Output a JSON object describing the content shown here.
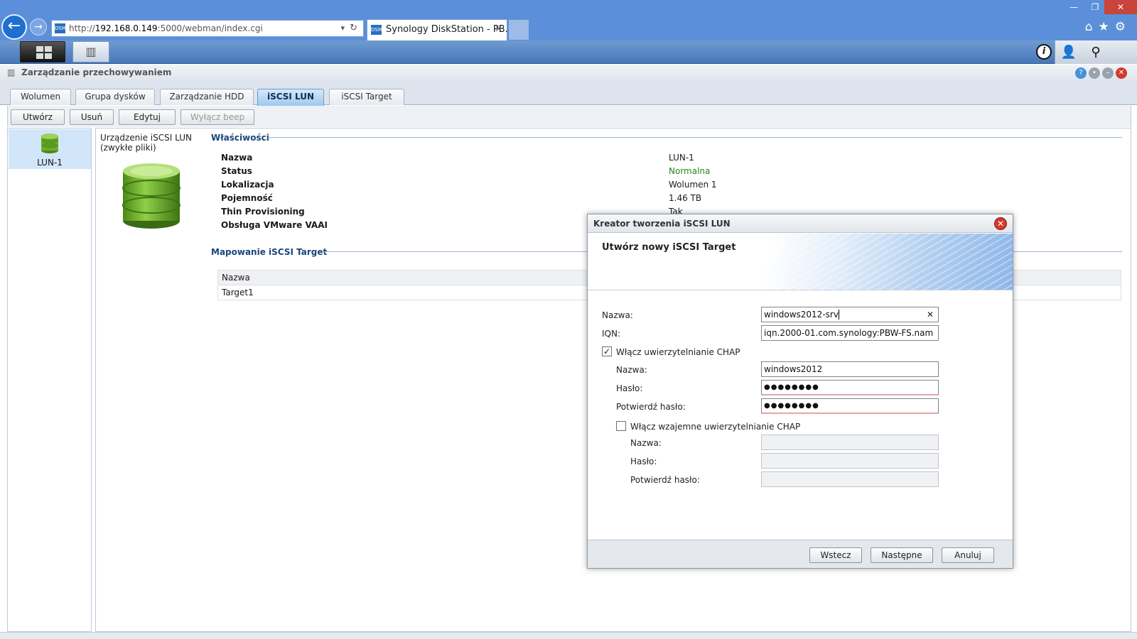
{
  "browser": {
    "address_prefix": "http://",
    "address_host": "192.168.0.149",
    "address_rest": ":5000/webman/index.cgi",
    "tab_title": "Synology DiskStation - PB...",
    "favicon_text": "DSM"
  },
  "app": {
    "title": "Zarządzanie przechowywaniem",
    "tabs": [
      "Wolumen",
      "Grupa dysków",
      "Zarządzanie HDD",
      "iSCSI LUN",
      "iSCSI Target"
    ],
    "active_tab": "iSCSI LUN"
  },
  "toolbar": {
    "create": "Utwórz",
    "delete": "Usuń",
    "edit": "Edytuj",
    "beep_off": "Wyłącz beep"
  },
  "lun_list": [
    {
      "label": "LUN-1"
    }
  ],
  "device": {
    "line1": "Urządzenie iSCSI LUN",
    "line2": "(zwykłe pliki)"
  },
  "properties": {
    "heading": "Właściwości",
    "rows": [
      {
        "key": "Nazwa",
        "value": "LUN-1"
      },
      {
        "key": "Status",
        "value": "Normalna"
      },
      {
        "key": "Lokalizacja",
        "value": "Wolumen 1"
      },
      {
        "key": "Pojemność",
        "value": "1.46 TB"
      },
      {
        "key": "Thin Provisioning",
        "value": "Tak"
      },
      {
        "key": "Obsługa VMware VAAI",
        "value": ""
      }
    ],
    "status_color": "#1f8a1f"
  },
  "mapping": {
    "heading": "Mapowanie iSCSI Target",
    "column": "Nazwa",
    "rows": [
      "Target1"
    ]
  },
  "wizard": {
    "title": "Kreator tworzenia iSCSI LUN",
    "step_title": "Utwórz nowy iSCSI Target",
    "name_label": "Nazwa:",
    "name_value": "windows2012-srv",
    "iqn_label": "IQN:",
    "iqn_value": "iqn.2000-01.com.synology:PBW-FS.nam",
    "chap_label": "Włącz uwierzytelnianie CHAP",
    "chap_checked": "✓",
    "chap_name_label": "Nazwa:",
    "chap_name_value": "windows2012",
    "chap_pass_label": "Hasło:",
    "chap_pass_value": "●●●●●●●●",
    "chap_confirm_label": "Potwierdź hasło:",
    "chap_confirm_value": "●●●●●●●●",
    "mutual_label": "Włącz wzajemne uwierzytelnianie CHAP",
    "mutual_name_label": "Nazwa:",
    "mutual_pass_label": "Hasło:",
    "mutual_confirm_label": "Potwierdź hasło:",
    "back": "Wstecz",
    "next": "Następne",
    "cancel": "Anuluj"
  }
}
